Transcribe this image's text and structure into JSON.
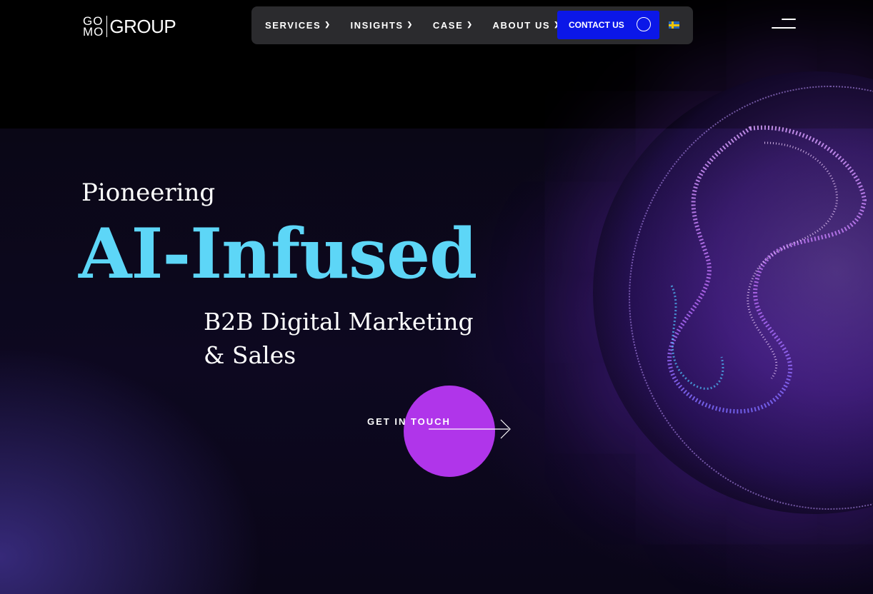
{
  "header": {
    "logo": {
      "mark_top": "GO",
      "mark_bottom": "MO",
      "word": "GROUP"
    },
    "nav": [
      {
        "label": "SERVICES",
        "has_dropdown": true
      },
      {
        "label": "INSIGHTS",
        "has_dropdown": true
      },
      {
        "label": "CASE",
        "has_dropdown": true
      },
      {
        "label": "ABOUT US",
        "has_dropdown": true
      }
    ],
    "contact_button": "CONTACT US",
    "language_flag": "swedish-flag-icon",
    "menu_icon": "hamburger-menu-icon"
  },
  "hero": {
    "eyebrow": "Pioneering",
    "title": "AI-Infused",
    "subtitle_line1": "B2B Digital Marketing",
    "subtitle_line2": "& Sales",
    "cta_label": "GET IN TOUCH"
  },
  "colors": {
    "title_accent": "#5dd6f7",
    "contact_button": "#0b17e8",
    "cta_circle": "#b035ea",
    "navbar_bg": "#2b2b2e"
  }
}
